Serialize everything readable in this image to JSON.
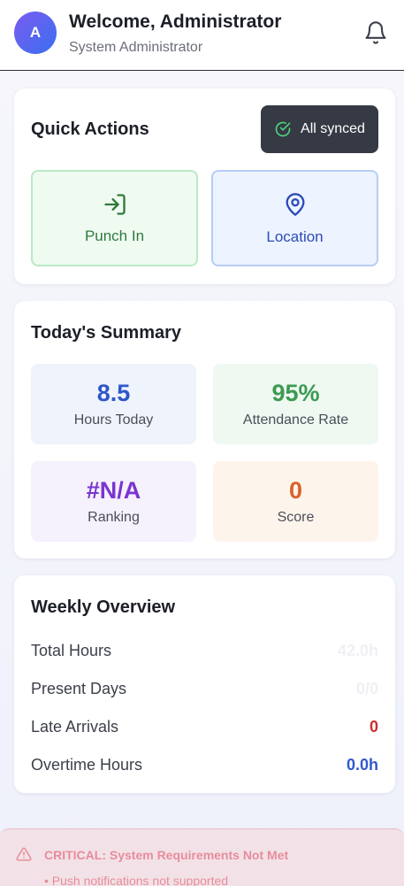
{
  "header": {
    "avatar_initial": "A",
    "welcome": "Welcome, Administrator",
    "role": "System Administrator",
    "bell_icon": "bell-icon"
  },
  "quick_actions": {
    "title": "Quick Actions",
    "sync_status": "All synced",
    "punch_in": "Punch In",
    "location": "Location"
  },
  "summary": {
    "title": "Today's Summary",
    "stats": [
      {
        "value": "8.5",
        "label": "Hours Today",
        "color": "#2f56c9",
        "bg": "#eef3fc"
      },
      {
        "value": "95%",
        "label": "Attendance Rate",
        "color": "#3c9a52",
        "bg": "#eff8f1"
      },
      {
        "value": "#N/A",
        "label": "Ranking",
        "color": "#7a35d0",
        "bg": "#f5f1fd"
      },
      {
        "value": "0",
        "label": "Score",
        "color": "#d9622a",
        "bg": "#fdf4ec"
      }
    ]
  },
  "weekly": {
    "title": "Weekly Overview",
    "rows": [
      {
        "label": "Total Hours",
        "value": "42.0h",
        "color": "#eef0f4"
      },
      {
        "label": "Present Days",
        "value": "0/0",
        "color": "#eef0f4"
      },
      {
        "label": "Late Arrivals",
        "value": "0",
        "color": "#cf2d2d"
      },
      {
        "label": "Overtime Hours",
        "value": "0.0h",
        "color": "#3158cf"
      }
    ]
  },
  "alert": {
    "text": "CRITICAL: System Requirements Not Met",
    "sub": "• Push notifications not supported"
  },
  "colors": {
    "accent": "#3a6ff0",
    "sync_bg": "#353a45",
    "alert_red": "#e23b4b"
  }
}
